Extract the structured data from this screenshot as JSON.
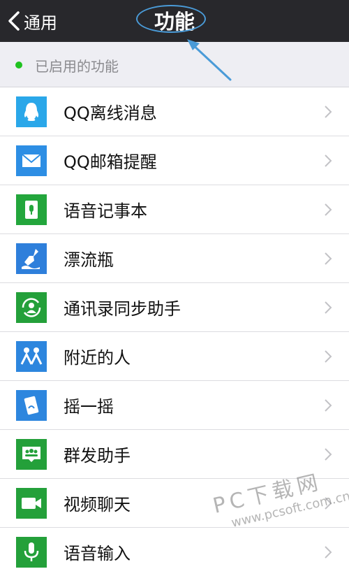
{
  "nav": {
    "back_label": "通用",
    "title": "功能"
  },
  "section": {
    "label": "已启用的功能"
  },
  "features": [
    {
      "label": "QQ离线消息",
      "icon": "qq-penguin-icon",
      "color": "#2aa7e9"
    },
    {
      "label": "QQ邮箱提醒",
      "icon": "mail-icon",
      "color": "#2d8ee4"
    },
    {
      "label": "语音记事本",
      "icon": "voice-notebook-icon",
      "color": "#23a63c"
    },
    {
      "label": "漂流瓶",
      "icon": "drift-bottle-icon",
      "color": "#2e7fdb"
    },
    {
      "label": "通讯录同步助手",
      "icon": "contact-sync-icon",
      "color": "#24a03a"
    },
    {
      "label": "附近的人",
      "icon": "people-nearby-icon",
      "color": "#2d86de"
    },
    {
      "label": "摇一摇",
      "icon": "shake-icon",
      "color": "#2d86de"
    },
    {
      "label": "群发助手",
      "icon": "broadcast-icon",
      "color": "#24a03a"
    },
    {
      "label": "视频聊天",
      "icon": "video-call-icon",
      "color": "#24a03a"
    },
    {
      "label": "语音输入",
      "icon": "voice-input-icon",
      "color": "#24a03a"
    }
  ],
  "watermark": {
    "top": "PC下载网",
    "bottom": "www.pcsoft.com.cn"
  },
  "colors": {
    "navbar": "#28282c",
    "annotation": "#4a9bd8",
    "enabled_dot": "#1fc21f"
  }
}
